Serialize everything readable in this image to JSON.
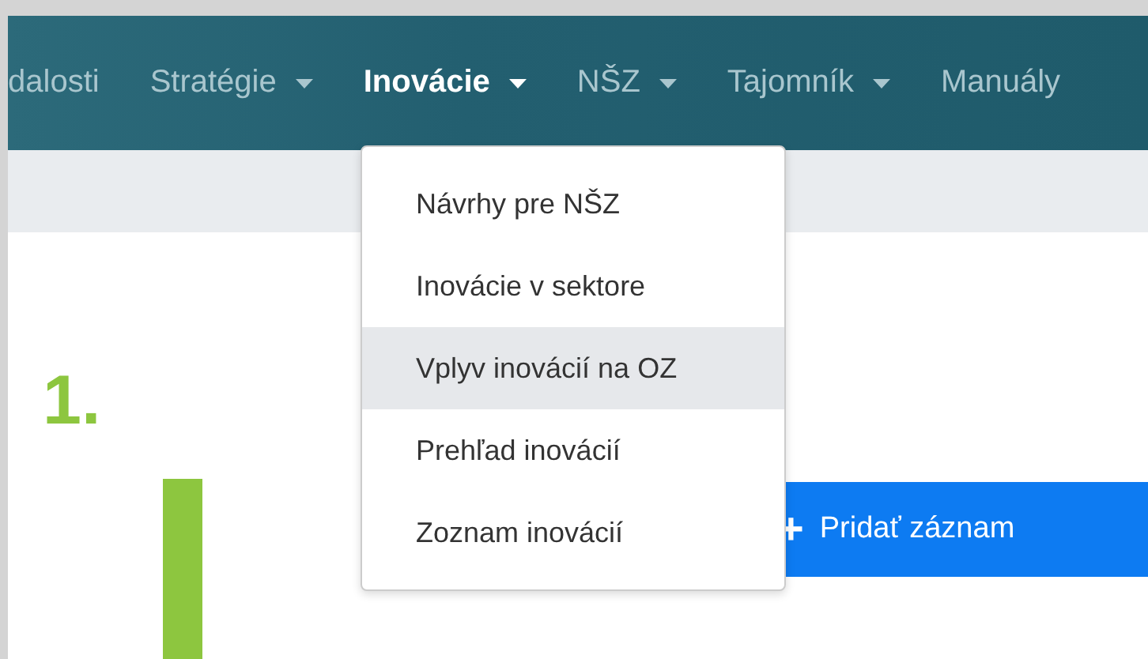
{
  "nav": {
    "items": [
      {
        "label": "dalosti",
        "dropdown": false,
        "selected": false
      },
      {
        "label": "Stratégie",
        "dropdown": true,
        "selected": false
      },
      {
        "label": "Inovácie",
        "dropdown": true,
        "selected": true
      },
      {
        "label": "NŠZ",
        "dropdown": true,
        "selected": false
      },
      {
        "label": "Tajomník",
        "dropdown": true,
        "selected": false
      },
      {
        "label": "Manuály",
        "dropdown": false,
        "selected": false
      }
    ]
  },
  "dropdown_menu": {
    "items": [
      {
        "label": "Návrhy pre NŠZ",
        "selected": false
      },
      {
        "label": "Inovácie v sektore",
        "selected": false
      },
      {
        "label": "Vplyv inovácií na OZ",
        "selected": true
      },
      {
        "label": "Prehľad inovácií",
        "selected": false
      },
      {
        "label": "Zoznam inovácií",
        "selected": false
      }
    ]
  },
  "annotation": {
    "label": "1."
  },
  "add_button": {
    "icon": "+",
    "label": "Pridať záznam"
  }
}
